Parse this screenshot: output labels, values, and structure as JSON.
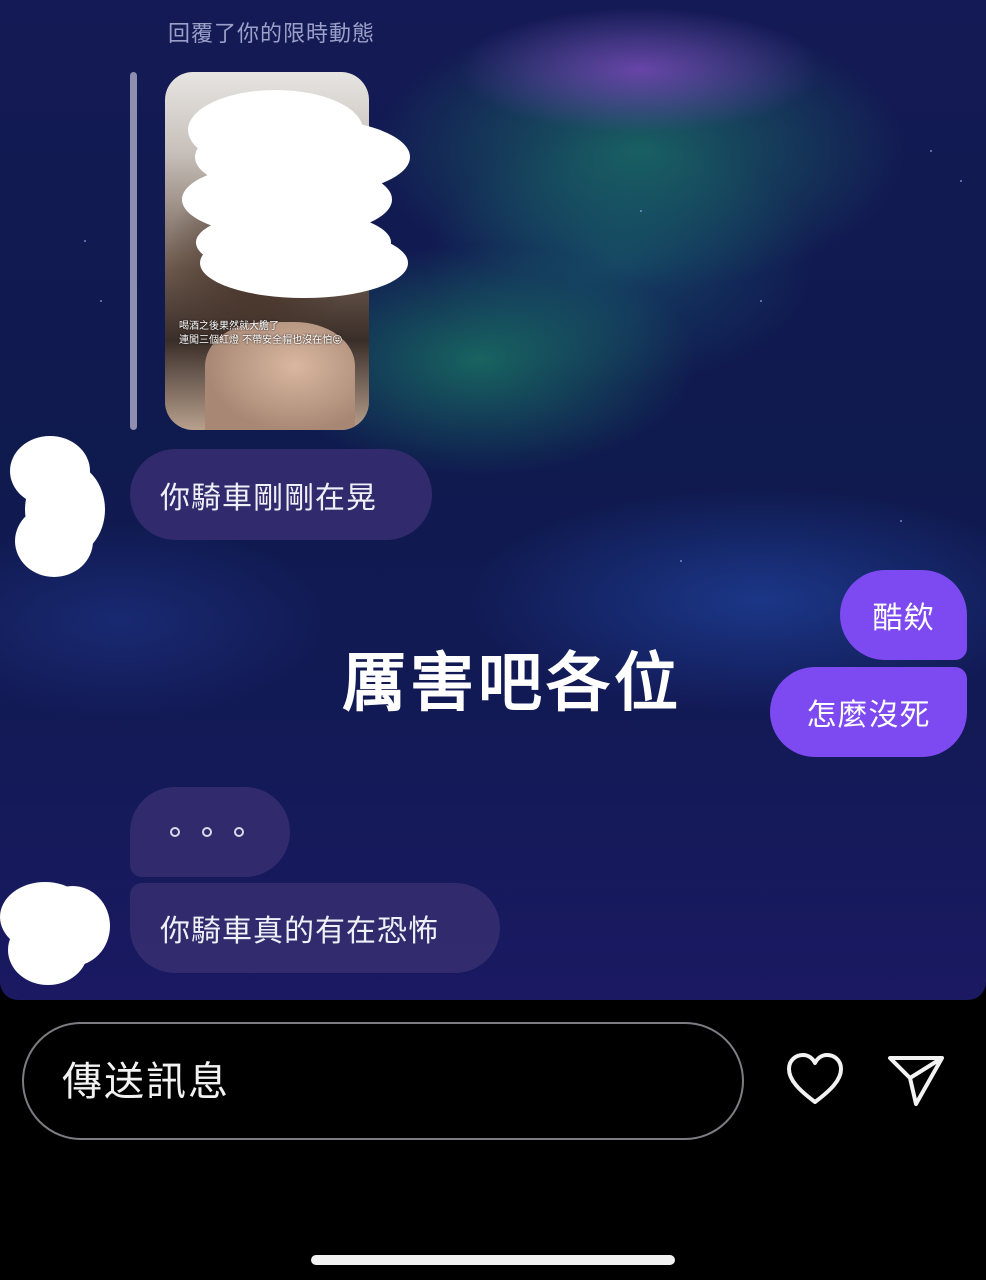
{
  "conversation": {
    "reply_label": "回覆了你的限時動態",
    "story_preview": {
      "caption_lines": [
        "喝酒之後果然就大膽了",
        "連闖三個紅燈 不帶安全帽也沒在怕😛"
      ]
    },
    "messages": [
      {
        "sender": "other",
        "text": "你騎車剛剛在晃"
      },
      {
        "sender": "me",
        "text": "酷欸"
      },
      {
        "sender": "me",
        "text": "怎麼沒死"
      },
      {
        "sender": "other",
        "text": "。。。"
      },
      {
        "sender": "other",
        "text": "你騎車真的有在恐怖"
      }
    ]
  },
  "overlay_caption": "厲害吧各位",
  "composer": {
    "placeholder": "傳送訊息",
    "like_icon": "heart-icon",
    "send_icon": "send-icon"
  },
  "colors": {
    "outgoing_bubble": "#7c4af0",
    "incoming_bubble": "#342c70",
    "background_top": "#141a55",
    "background_bottom": "#1a1962"
  }
}
